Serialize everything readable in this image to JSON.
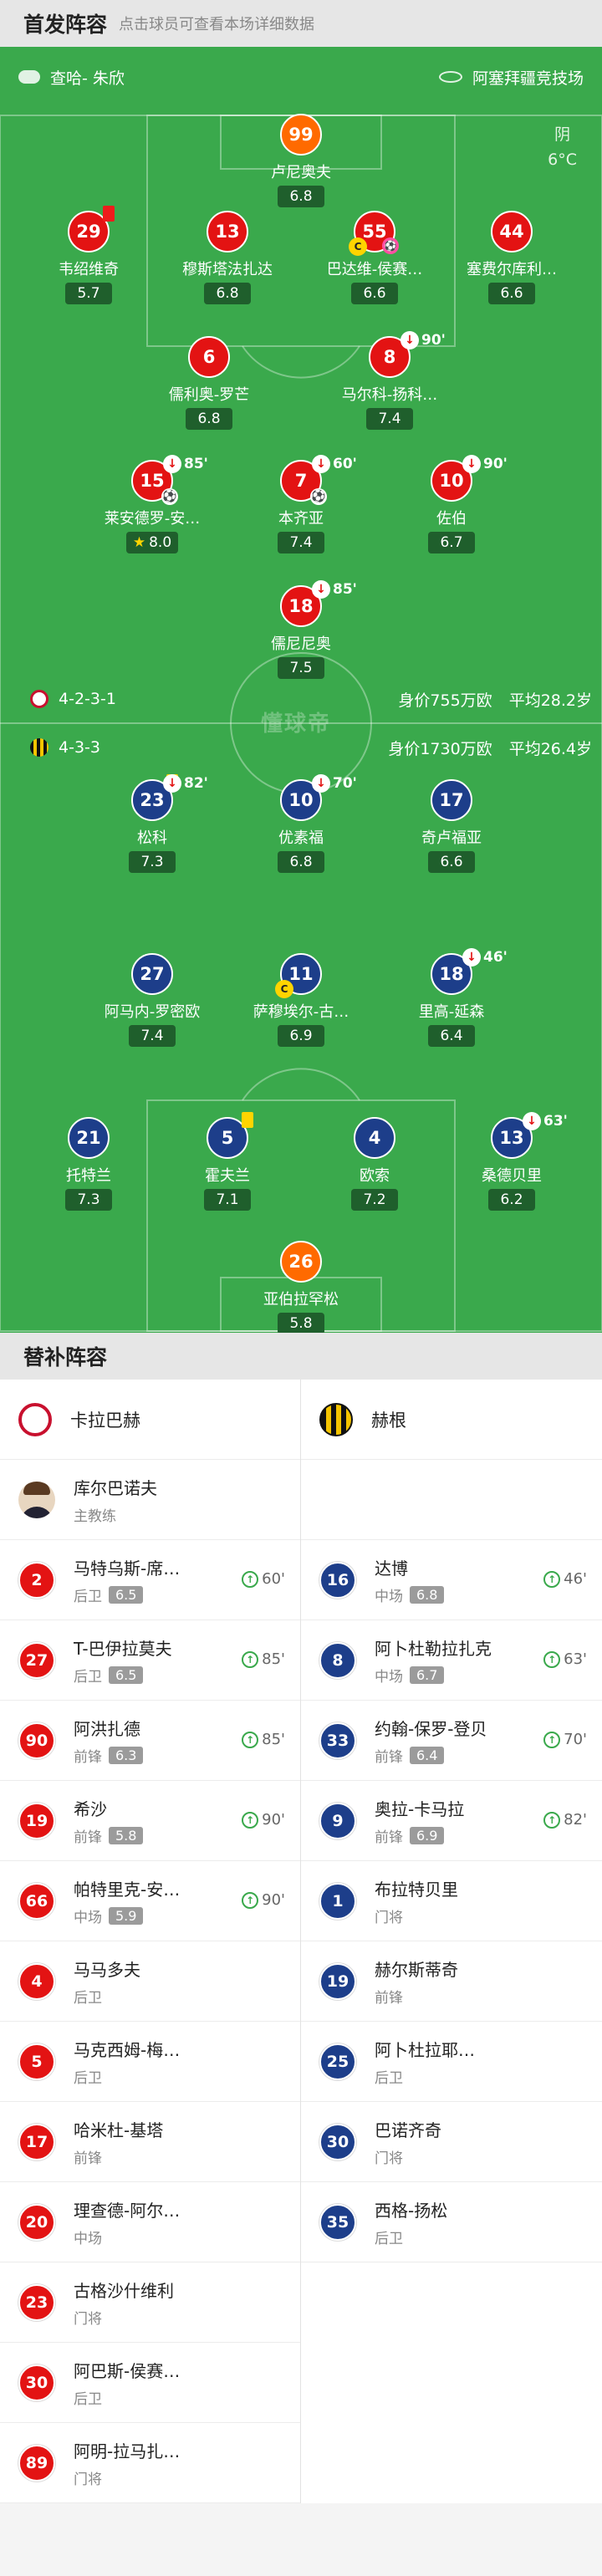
{
  "header": {
    "title": "首发阵容",
    "hint": "点击球员可查看本场详细数据"
  },
  "match": {
    "referee": "查哈- 朱欣",
    "stadium": "阿塞拜疆竞技场",
    "weather": "阴",
    "temp": "6°C"
  },
  "brand": "懂球帝",
  "home": {
    "formation": "4-2-3-1",
    "value": "身价755万欧",
    "age": "平均28.2岁",
    "players": [
      {
        "num": "99",
        "name": "卢尼奥夫",
        "rate": "6.8",
        "gk": true
      },
      {
        "num": "29",
        "name": "韦绍维奇",
        "rate": "5.7",
        "red": true
      },
      {
        "num": "13",
        "name": "穆斯塔法扎达",
        "rate": "6.8"
      },
      {
        "num": "55",
        "name": "巴达维-侯赛…",
        "rate": "6.6",
        "cap": true,
        "own": true
      },
      {
        "num": "44",
        "name": "塞费尔库利…",
        "rate": "6.6"
      },
      {
        "num": "6",
        "name": "儒利奥-罗芒",
        "rate": "6.8"
      },
      {
        "num": "8",
        "name": "马尔科-扬科…",
        "rate": "7.4",
        "out": "90'"
      },
      {
        "num": "15",
        "name": "莱安德罗-安…",
        "rate": "8.0",
        "out": "85'",
        "goal": true,
        "star": true
      },
      {
        "num": "7",
        "name": "本齐亚",
        "rate": "7.4",
        "out": "60'",
        "goal": true
      },
      {
        "num": "10",
        "name": "佐伯",
        "rate": "6.7",
        "out": "90'"
      },
      {
        "num": "18",
        "name": "儒尼尼奥",
        "rate": "7.5",
        "out": "85'"
      }
    ]
  },
  "away": {
    "formation": "4-3-3",
    "value": "身价1730万欧",
    "age": "平均26.4岁",
    "players": [
      {
        "num": "23",
        "name": "松科",
        "rate": "7.3",
        "out": "82'",
        "yellow": true
      },
      {
        "num": "10",
        "name": "优素福",
        "rate": "6.8",
        "out": "70'"
      },
      {
        "num": "17",
        "name": "奇卢福亚",
        "rate": "6.6"
      },
      {
        "num": "27",
        "name": "阿马内-罗密欧",
        "rate": "7.4"
      },
      {
        "num": "11",
        "name": "萨穆埃尔-古…",
        "rate": "6.9",
        "cap": true
      },
      {
        "num": "18",
        "name": "里高-延森",
        "rate": "6.4",
        "out": "46'"
      },
      {
        "num": "21",
        "name": "托特兰",
        "rate": "7.3"
      },
      {
        "num": "5",
        "name": "霍夫兰",
        "rate": "7.1",
        "yellow": true
      },
      {
        "num": "4",
        "name": "欧索",
        "rate": "7.2"
      },
      {
        "num": "13",
        "name": "桑德贝里",
        "rate": "6.2",
        "out": "63'"
      },
      {
        "num": "26",
        "name": "亚伯拉罕松",
        "rate": "5.8",
        "gk": true
      }
    ]
  },
  "subs": {
    "title": "替补阵容",
    "home_team": "卡拉巴赫",
    "away_team": "赫根",
    "coach": {
      "name": "库尔巴诺夫",
      "role": "主教练"
    },
    "home": [
      {
        "num": "2",
        "name": "马特乌斯-席…",
        "pos": "后卫",
        "rate": "6.5",
        "in": "60'"
      },
      {
        "num": "27",
        "name": "T-巴伊拉莫夫",
        "pos": "后卫",
        "rate": "6.5",
        "in": "85'"
      },
      {
        "num": "90",
        "name": "阿洪扎德",
        "pos": "前锋",
        "rate": "6.3",
        "in": "85'"
      },
      {
        "num": "19",
        "name": "希沙",
        "pos": "前锋",
        "rate": "5.8",
        "in": "90'"
      },
      {
        "num": "66",
        "name": "帕特里克-安…",
        "pos": "中场",
        "rate": "5.9",
        "in": "90'"
      },
      {
        "num": "4",
        "name": "马马多夫",
        "pos": "后卫"
      },
      {
        "num": "5",
        "name": "马克西姆-梅…",
        "pos": "后卫"
      },
      {
        "num": "17",
        "name": "哈米杜-基塔",
        "pos": "前锋"
      },
      {
        "num": "20",
        "name": "理查德-阿尔…",
        "pos": "中场"
      },
      {
        "num": "23",
        "name": "古格沙什维利",
        "pos": "门将"
      },
      {
        "num": "30",
        "name": "阿巴斯-侯赛…",
        "pos": "后卫"
      },
      {
        "num": "89",
        "name": "阿明-拉马扎…",
        "pos": "门将"
      }
    ],
    "away": [
      {
        "num": "16",
        "name": "达博",
        "pos": "中场",
        "rate": "6.8",
        "in": "46'"
      },
      {
        "num": "8",
        "name": "阿卜杜勒拉扎克",
        "pos": "中场",
        "rate": "6.7",
        "in": "63'"
      },
      {
        "num": "33",
        "name": "约翰-保罗-登贝",
        "pos": "前锋",
        "rate": "6.4",
        "in": "70'"
      },
      {
        "num": "9",
        "name": "奥拉-卡马拉",
        "pos": "前锋",
        "rate": "6.9",
        "in": "82'"
      },
      {
        "num": "1",
        "name": "布拉特贝里",
        "pos": "门将"
      },
      {
        "num": "19",
        "name": "赫尔斯蒂奇",
        "pos": "前锋"
      },
      {
        "num": "25",
        "name": "阿卜杜拉耶…",
        "pos": "后卫"
      },
      {
        "num": "30",
        "name": "巴诺齐奇",
        "pos": "门将"
      },
      {
        "num": "35",
        "name": "西格-扬松",
        "pos": "后卫"
      }
    ]
  },
  "colors": {
    "pitch": "#3aa94c",
    "home": "#e31313",
    "away": "#1d3e8a",
    "gk": "#ff6a00"
  }
}
